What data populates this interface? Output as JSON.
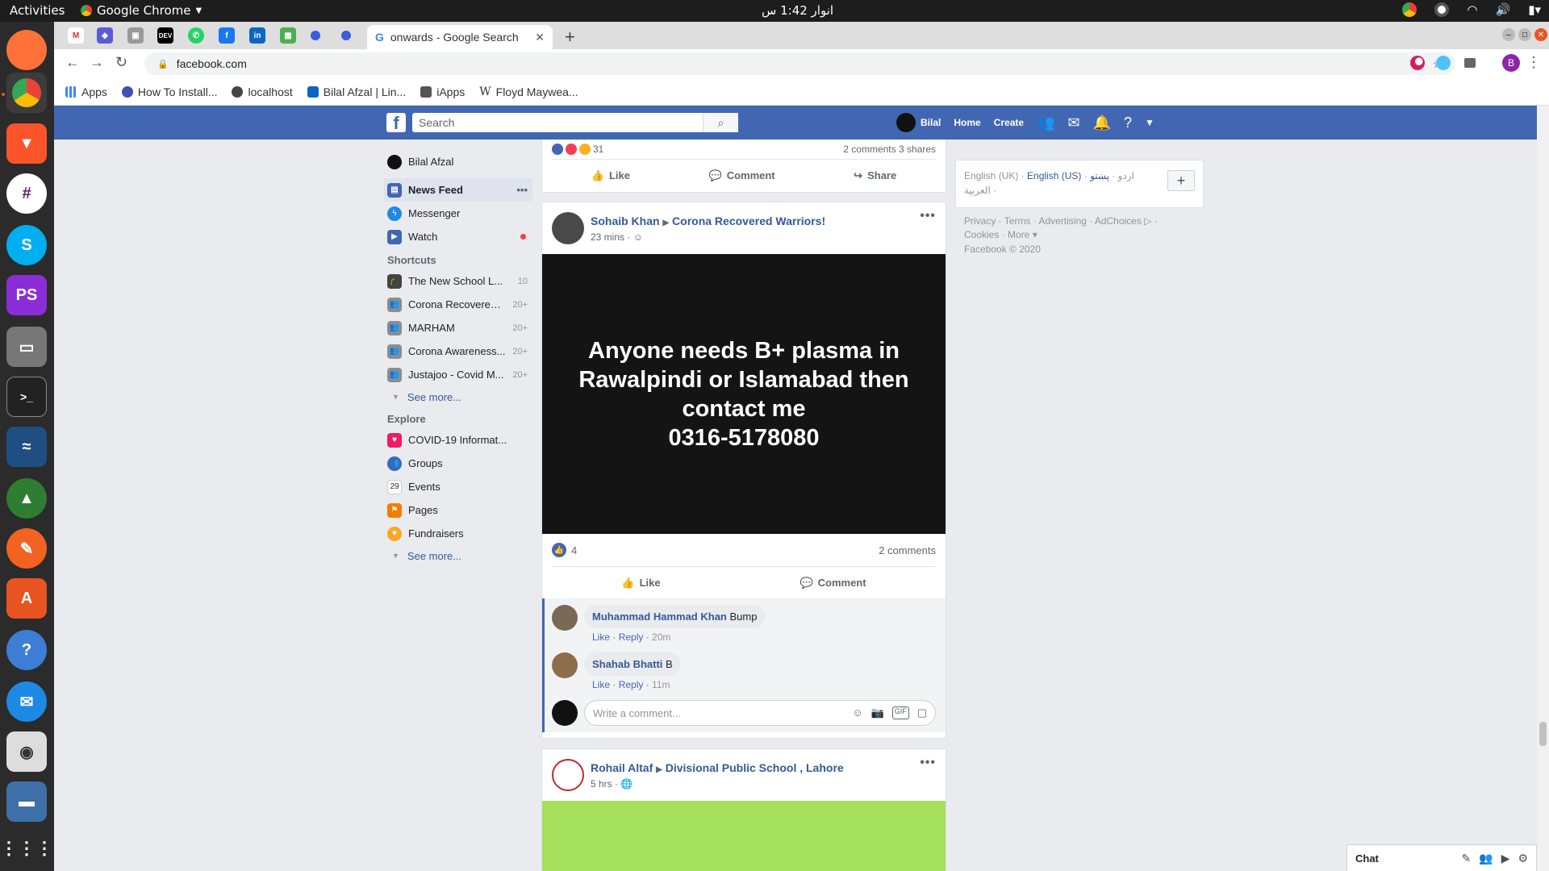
{
  "os": {
    "activities": "Activities",
    "app_name": "Google Chrome",
    "clock": "انوار 1:42 س"
  },
  "chrome": {
    "active_tab_title": "onwards - Google Search",
    "url": "facebook.com",
    "profile_initial": "B",
    "bookmarks": [
      "Apps",
      "How To Install...",
      "localhost",
      "Bilal Afzal | Lin...",
      "iApps",
      "Floyd Maywea..."
    ]
  },
  "fb": {
    "search_placeholder": "Search",
    "user": "Bilal",
    "nav_home": "Home",
    "nav_create": "Create",
    "left": {
      "profile_name": "Bilal Afzal",
      "news_feed": "News Feed",
      "messenger": "Messenger",
      "watch": "Watch",
      "shortcuts_header": "Shortcuts",
      "shortcuts": [
        {
          "label": "The New School L...",
          "count": "10"
        },
        {
          "label": "Corona Recovered ...",
          "count": "20+"
        },
        {
          "label": "MARHAM",
          "count": "20+"
        },
        {
          "label": "Corona Awareness...",
          "count": "20+"
        },
        {
          "label": "Justajoo - Covid M...",
          "count": "20+"
        }
      ],
      "see_more": "See more...",
      "explore_header": "Explore",
      "explore": [
        "COVID-19 Informat...",
        "Groups",
        "Events",
        "Pages",
        "Fundraisers"
      ]
    },
    "post1": {
      "reaction_count": "31",
      "comments": "2 comments",
      "shares": "3 shares",
      "like": "Like",
      "comment": "Comment",
      "share": "Share"
    },
    "post2": {
      "author": "Sohaib Khan",
      "group": "Corona Recovered Warriors!",
      "time": "23 mins ·",
      "text_lines": [
        "Anyone needs B+ plasma in",
        "Rawalpindi or Islamabad then",
        "contact me",
        "0316-5178080"
      ],
      "like_count": "4",
      "comments_count": "2 comments",
      "like": "Like",
      "comment": "Comment",
      "comment_list": [
        {
          "name": "Muhammad Hammad Khan",
          "text": "Bump",
          "like": "Like",
          "reply": "Reply",
          "time": "20m"
        },
        {
          "name": "Shahab Bhatti",
          "text": "B",
          "like": "Like",
          "reply": "Reply",
          "time": "11m"
        }
      ],
      "write_placeholder": "Write a comment..."
    },
    "post3": {
      "author": "Rohail Altaf",
      "group": "Divisional Public School , Lahore",
      "time": "5 hrs ·"
    },
    "right": {
      "lang_uk": "English (UK)",
      "lang_us": "English (US)",
      "lang_ur": "اردو",
      "lang_ps": "پښتو",
      "lang_ar": "العربية",
      "links1": "Privacy · Terms · Advertising · AdChoices ▷ ·",
      "links2": "Cookies · More ▾",
      "copyright": "Facebook © 2020"
    },
    "chat_label": "Chat"
  }
}
